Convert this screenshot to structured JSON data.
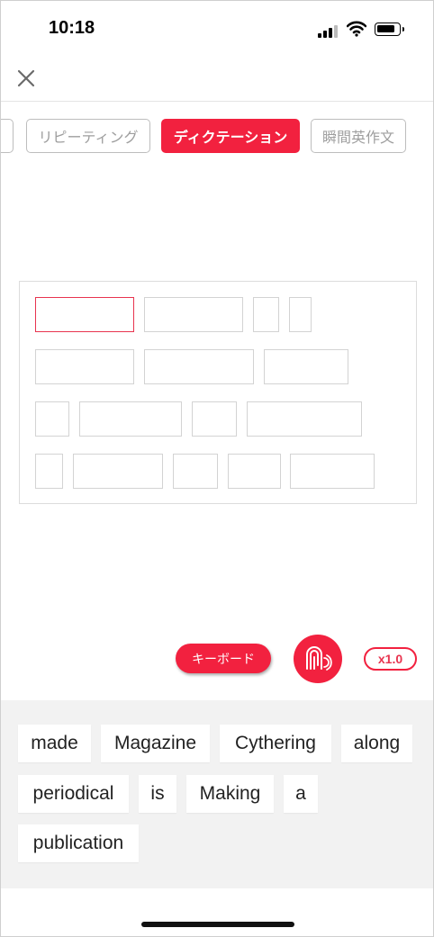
{
  "status_bar": {
    "time": "10:18"
  },
  "tabs": [
    {
      "label": "リピーティング",
      "active": false
    },
    {
      "label": "ディクテーション",
      "active": true
    },
    {
      "label": "瞬間英作文",
      "active": false
    }
  ],
  "answer_rows": [
    {
      "slot_count": 4
    },
    {
      "slot_count": 3
    },
    {
      "slot_count": 4
    },
    {
      "slot_count": 5
    }
  ],
  "controls": {
    "keyboard_label": "キーボード",
    "speed_label": "x1.0",
    "mic_icon": "fingerprint-sound-icon"
  },
  "word_bank": {
    "rows": [
      [
        "made",
        "Magazine",
        "Cythering",
        "along"
      ],
      [
        "periodical",
        "is",
        "Making",
        "a"
      ],
      [
        "publication"
      ]
    ]
  },
  "colors": {
    "accent": "#f2213f",
    "slot_border": "#d3d3d3",
    "bank_background": "#f2f2f2"
  }
}
